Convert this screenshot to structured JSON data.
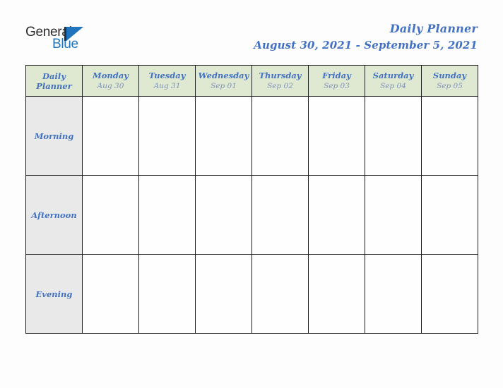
{
  "logo": {
    "word_one": "General",
    "word_two": "Blue",
    "mark_icon": "triangle-logo-icon",
    "brand_blue": "#1f74bd",
    "brand_dark": "#2b2b2b"
  },
  "header": {
    "title": "Daily Planner",
    "date_range": "August 30, 2021 - September 5, 2021",
    "title_color": "#4372c4"
  },
  "table": {
    "corner": {
      "line1": "Daily",
      "line2": "Planner"
    },
    "header_bg": "#dfe8d0",
    "label_bg": "#e9e9e9",
    "border_color": "#1c1c1c",
    "columns": [
      {
        "day": "Monday",
        "date": "Aug 30"
      },
      {
        "day": "Tuesday",
        "date": "Aug 31"
      },
      {
        "day": "Wednesday",
        "date": "Sep 01"
      },
      {
        "day": "Thursday",
        "date": "Sep 02"
      },
      {
        "day": "Friday",
        "date": "Sep 03"
      },
      {
        "day": "Saturday",
        "date": "Sep 04"
      },
      {
        "day": "Sunday",
        "date": "Sep 05"
      }
    ],
    "rows": [
      {
        "label": "Morning"
      },
      {
        "label": "Afternoon"
      },
      {
        "label": "Evening"
      }
    ]
  }
}
